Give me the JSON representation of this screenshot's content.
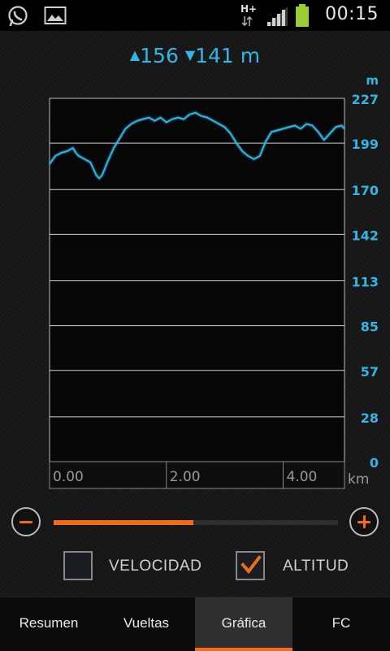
{
  "status_bar": {
    "time": "00:15",
    "network": "H+",
    "icons": [
      "whatsapp-icon",
      "image-icon",
      "network-icon",
      "signal-icon",
      "battery-icon"
    ]
  },
  "elevation": {
    "up_value": "156",
    "down_value": "141",
    "unit": "m"
  },
  "chart_data": {
    "type": "line",
    "y_unit_label": "m",
    "x_unit_label": "km",
    "y_ticks": [
      "227",
      "199",
      "170",
      "142",
      "113",
      "85",
      "57",
      "28",
      "0"
    ],
    "x_ticks": [
      "0.00",
      "2.00",
      "4.00"
    ],
    "ylim": [
      0,
      227
    ],
    "xlim": [
      0,
      5.05
    ],
    "grid": true,
    "series": [
      {
        "color": "#33b5e5",
        "x": [
          0.0,
          0.1,
          0.2,
          0.3,
          0.4,
          0.45,
          0.5,
          0.6,
          0.7,
          0.8,
          0.85,
          0.9,
          1.0,
          1.1,
          1.2,
          1.3,
          1.4,
          1.5,
          1.6,
          1.7,
          1.8,
          1.9,
          2.0,
          2.1,
          2.2,
          2.3,
          2.4,
          2.5,
          2.6,
          2.7,
          2.8,
          2.9,
          3.0,
          3.1,
          3.2,
          3.3,
          3.4,
          3.5,
          3.6,
          3.7,
          3.8,
          3.9,
          4.0,
          4.1,
          4.2,
          4.3,
          4.4,
          4.5,
          4.6,
          4.7,
          4.8,
          4.9,
          5.0,
          5.05
        ],
        "y": [
          186,
          191,
          193,
          194,
          196,
          193,
          191,
          189,
          187,
          179,
          177,
          179,
          188,
          196,
          202,
          208,
          211,
          213,
          214,
          215,
          213,
          215,
          212,
          214,
          215,
          214,
          217,
          218,
          216,
          215,
          213,
          211,
          209,
          205,
          199,
          194,
          191,
          189,
          191,
          200,
          206,
          207,
          208,
          209,
          210,
          208,
          211,
          210,
          206,
          201,
          205,
          209,
          210,
          208
        ]
      }
    ]
  },
  "zoom": {
    "level": 0.49,
    "minus_icon": "minus-icon",
    "plus_icon": "plus-icon"
  },
  "checkboxes": [
    {
      "label": "VELOCIDAD",
      "checked": false
    },
    {
      "label": "ALTITUD",
      "checked": true
    }
  ],
  "tabs": [
    {
      "label": "Resumen",
      "active": false
    },
    {
      "label": "Vueltas",
      "active": false
    },
    {
      "label": "Gráfica",
      "active": true
    },
    {
      "label": "FC",
      "active": false
    }
  ],
  "colors": {
    "accent": "#f36b16",
    "line": "#33b5e5"
  }
}
